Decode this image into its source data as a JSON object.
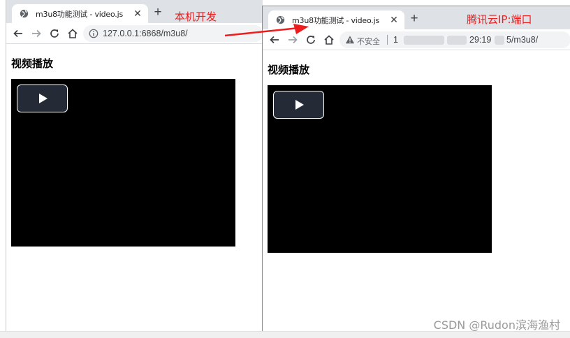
{
  "left_browser": {
    "tab_title": "m3u8功能测试 - video.js",
    "url": "127.0.0.1:6868/m3u8/",
    "page_heading": "视频播放"
  },
  "right_browser": {
    "tab_title": "m3u8功能测试 - video.js",
    "security_label": "不安全",
    "url_visible_parts": [
      "1",
      "29:19",
      "5/m3u8/"
    ],
    "page_heading": "视频播放"
  },
  "annotations": {
    "left_label": "本机开发",
    "right_label": "腾讯云IP:端口",
    "color": "#ee1c1c"
  },
  "icons": {
    "tab_favicon": "globe-icon",
    "close": "close-icon",
    "new_tab": "plus-icon",
    "back": "arrow-left-icon",
    "forward": "arrow-right-icon",
    "reload": "reload-icon",
    "home": "home-icon",
    "site_info": "info-icon",
    "not_secure": "warning-icon",
    "play": "play-icon"
  },
  "watermark": "CSDN @Rudon滨海渔村"
}
